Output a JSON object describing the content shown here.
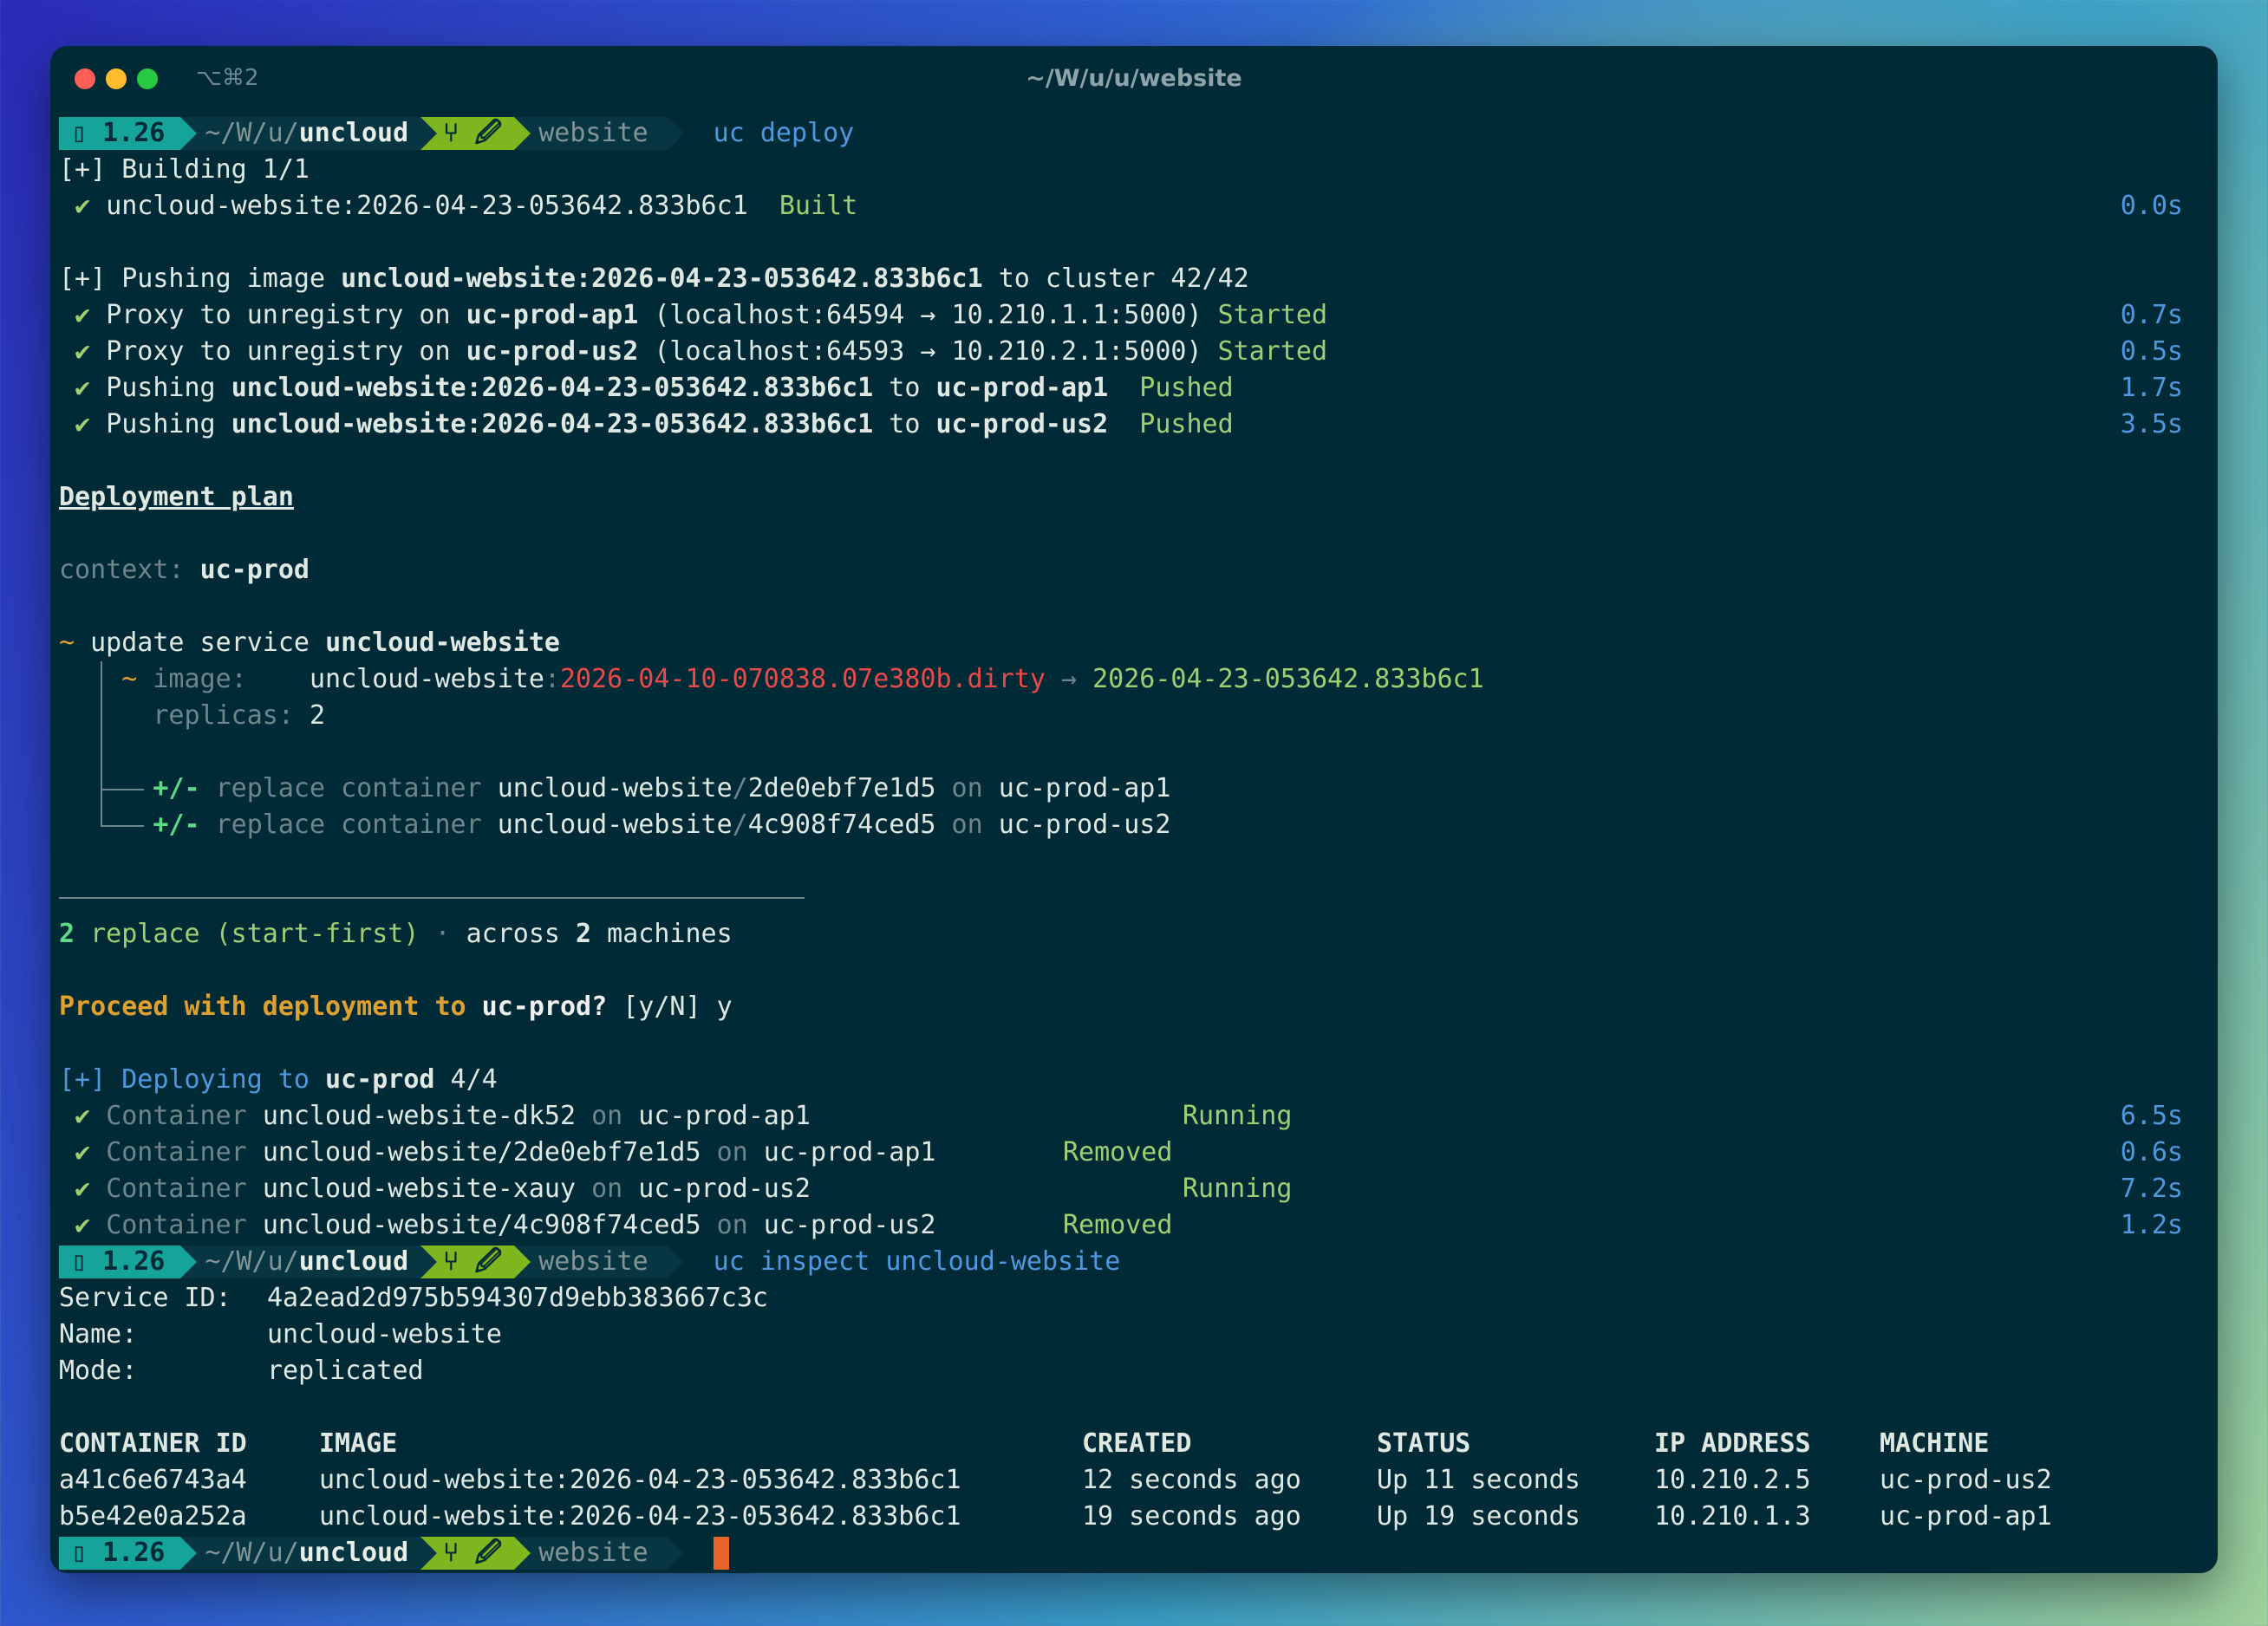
{
  "window": {
    "title": "~/W/u/u/website",
    "shortcut": "⌥⌘2"
  },
  "prompt": {
    "icon": "battery-icon",
    "version": "1.26",
    "path_prefix": "~/W/u/",
    "path_dir": "uncloud",
    "git_icons": "⑂ 🖉",
    "branch": "website"
  },
  "commands": {
    "deploy": "uc deploy",
    "inspect": "uc inspect uncloud-website"
  },
  "build": {
    "header": "[+] Building 1/1",
    "item": "uncloud-website:2026-04-23-053642.833b6c1",
    "status": "Built",
    "time": "0.0s"
  },
  "push": {
    "header_prefix": "[+] Pushing image ",
    "header_image": "uncloud-website:2026-04-23-053642.833b6c1",
    "header_suffix": " to cluster 42/42",
    "proxy1": {
      "prefix": "Proxy to unregistry on ",
      "host": "uc-prod-ap1",
      "detail": " (localhost:64594 → 10.210.1.1:5000) ",
      "status": "Started",
      "time": "0.7s"
    },
    "proxy2": {
      "prefix": "Proxy to unregistry on ",
      "host": "uc-prod-us2",
      "detail": " (localhost:64593 → 10.210.2.1:5000) ",
      "status": "Started",
      "time": "0.5s"
    },
    "push1": {
      "prefix": "Pushing ",
      "image": "uncloud-website:2026-04-23-053642.833b6c1",
      "mid": " to ",
      "host": "uc-prod-ap1",
      "status": "Pushed",
      "time": "1.7s"
    },
    "push2": {
      "prefix": "Pushing ",
      "image": "uncloud-website:2026-04-23-053642.833b6c1",
      "mid": " to ",
      "host": "uc-prod-us2",
      "status": "Pushed",
      "time": "3.5s"
    }
  },
  "plan": {
    "title": "Deployment plan",
    "context_label": "context: ",
    "context_value": "uc-prod",
    "update_prefix": "update service ",
    "service": "uncloud-website",
    "image_label": "image:",
    "image_name": "uncloud-website",
    "image_old": "2026-04-10-070838.07e380b.dirty",
    "image_new": "2026-04-23-053642.833b6c1",
    "replicas_label": "replicas: ",
    "replicas_value": "2",
    "replace1": {
      "op": "+/-",
      "action": " replace container ",
      "name": "uncloud-website",
      "id": "2de0ebf7e1d5",
      "on": " on ",
      "host": "uc-prod-ap1"
    },
    "replace2": {
      "op": "+/-",
      "action": " replace container ",
      "name": "uncloud-website",
      "id": "4c908f74ced5",
      "on": " on ",
      "host": "uc-prod-us2"
    },
    "summary_count": "2",
    "summary_text": " replace (start-first)",
    "summary_sep": " · ",
    "summary_across": "across ",
    "summary_machines_count": "2",
    "summary_machines": " machines"
  },
  "confirm": {
    "prefix": "Proceed with deployment to ",
    "target": "uc-prod?",
    "options": " [y/N] ",
    "answer": "y"
  },
  "deploying": {
    "header_prefix": "[+] Deploying to ",
    "target": "uc-prod",
    "progress": " 4/4",
    "rows": [
      {
        "label": "Container ",
        "name": "uncloud-website-dk52",
        "on": " on ",
        "host": "uc-prod-ap1",
        "status": "Running",
        "time": "6.5s"
      },
      {
        "label": "Container ",
        "name": "uncloud-website/2de0ebf7e1d5",
        "on": " on ",
        "host": "uc-prod-ap1",
        "status": "Removed",
        "time": "0.6s"
      },
      {
        "label": "Container ",
        "name": "uncloud-website-xauy",
        "on": " on ",
        "host": "uc-prod-us2",
        "status": "Running",
        "time": "7.2s"
      },
      {
        "label": "Container ",
        "name": "uncloud-website/4c908f74ced5",
        "on": " on ",
        "host": "uc-prod-us2",
        "status": "Removed",
        "time": "1.2s"
      }
    ]
  },
  "inspect": {
    "service_id_label": "Service ID:",
    "service_id": "4a2ead2d975b594307d9ebb383667c3c",
    "name_label": "Name:",
    "name": "uncloud-website",
    "mode_label": "Mode:",
    "mode": "replicated",
    "headers": [
      "CONTAINER ID",
      "IMAGE",
      "CREATED",
      "STATUS",
      "IP ADDRESS",
      "MACHINE"
    ],
    "rows": [
      {
        "id": "a41c6e6743a4",
        "image": "uncloud-website:2026-04-23-053642.833b6c1",
        "created": "12 seconds ago",
        "status": "Up 11 seconds",
        "ip": "10.210.2.5",
        "machine": "uc-prod-us2"
      },
      {
        "id": "b5e42e0a252a",
        "image": "uncloud-website:2026-04-23-053642.833b6c1",
        "created": "19 seconds ago",
        "status": "Up 19 seconds",
        "ip": "10.210.1.3",
        "machine": "uc-prod-ap1"
      }
    ]
  },
  "check": "✔",
  "tilde": "~"
}
